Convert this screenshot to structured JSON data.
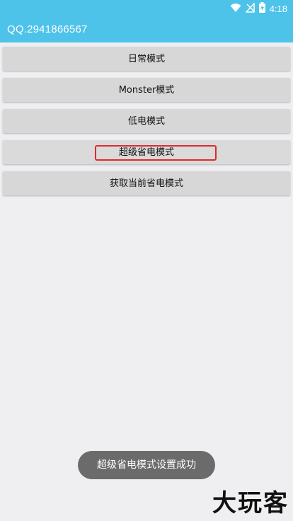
{
  "status_bar": {
    "time": "4:18",
    "icons": [
      "wifi-icon",
      "no-signal-icon",
      "battery-charging-icon"
    ]
  },
  "app_bar": {
    "title": "QQ.2941866567"
  },
  "buttons": [
    {
      "label": "日常模式"
    },
    {
      "label": "Monster模式"
    },
    {
      "label": "低电模式"
    },
    {
      "label": "超级省电模式"
    },
    {
      "label": "获取当前省电模式"
    }
  ],
  "toast": {
    "message": "超级省电模式设置成功"
  },
  "watermark": {
    "text": "大玩客"
  },
  "colors": {
    "accent": "#4dc3ea",
    "button_bg": "#d7d7d7",
    "highlight": "#e02a2a",
    "toast_bg": "#6b6b6b"
  }
}
